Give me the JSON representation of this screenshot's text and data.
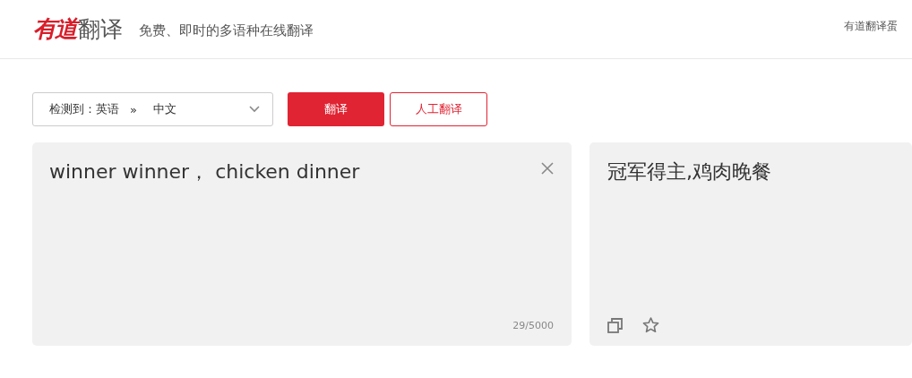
{
  "header": {
    "logo_brand": "有道",
    "logo_product": "翻译",
    "tagline": "免费、即时的多语种在线翻译",
    "link": "有道翻译蛋"
  },
  "language_select": {
    "detected": "检测到：英语",
    "separator": "»",
    "target": "中文"
  },
  "buttons": [
    {
      "label": "翻译",
      "kind": "primary"
    },
    {
      "label": "人工翻译",
      "kind": "outline"
    }
  ],
  "input": {
    "value": "winner winner， chicken dinner",
    "counter": "29/5000"
  },
  "output": {
    "text": "冠军得主,鸡肉晚餐"
  }
}
